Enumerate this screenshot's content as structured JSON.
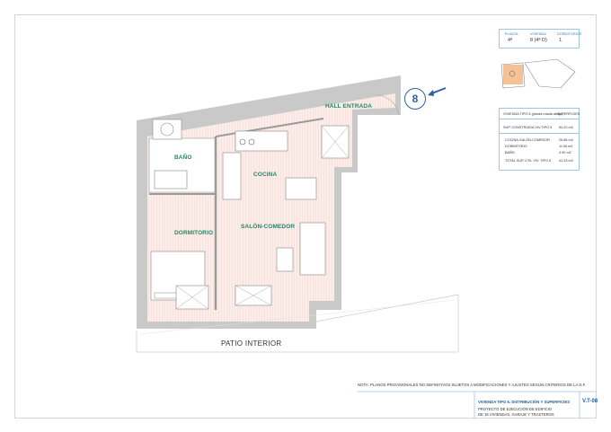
{
  "plan": {
    "unit_number": "8",
    "rooms": {
      "hall": "HALL ENTRADA",
      "bath": "BAÑO",
      "kitchen": "COCINA",
      "living": "SALÓN-COMEDOR",
      "bedroom": "DORMITORIO"
    },
    "patio": "PATIO INTERIOR"
  },
  "info_panel": {
    "header_labels": [
      "PLANTA",
      "VIVIENDA",
      "DORMITORIOS"
    ],
    "header_values": [
      "4ª",
      "8 (4ª D)",
      "1"
    ],
    "table_title": "VIVIENDA TIPO 6 (planta rotada abajo)",
    "table_col": "SUPERFICIES",
    "built_label": "SUP. CONSTRUIDA VIV.TIPO 6",
    "built_value": "54.20 m2",
    "rows": [
      {
        "name": "COCINA-SALÓN-COMEDOR",
        "value": "26.86 m2"
      },
      {
        "name": "DORMITORIO",
        "value": "11.06 m2"
      },
      {
        "name": "BAÑO",
        "value": "4.90 m2"
      },
      {
        "name": "TOTAL SUP. ÚTIL VIV. TIPO 6",
        "value": "41.33 m2"
      }
    ]
  },
  "title_block": {
    "note": "NOTA: PLANOS PROVISIONALES NO DEFINITIVOS SUJETOS A MODIFICACIONES Y AJUSTES SEGÚN CRITERIOS DE LA D.F.",
    "sheet_title": "VIVIENDA TIPO 6. DISTRIBUCIÓN Y SUPERFICIES",
    "project_line1": "PROYECTO DE EJECUCIÓN DE EDIFICIO",
    "project_line2": "DE 19 VIVIENDAS, GARAJE Y TRASTEROS",
    "sheet_code": "V.T-08"
  },
  "colors": {
    "wall": "#c8c8c8",
    "floor_hatch": "#f3c9c0",
    "room_label": "#27866a",
    "accent": "#2a5fa6"
  }
}
